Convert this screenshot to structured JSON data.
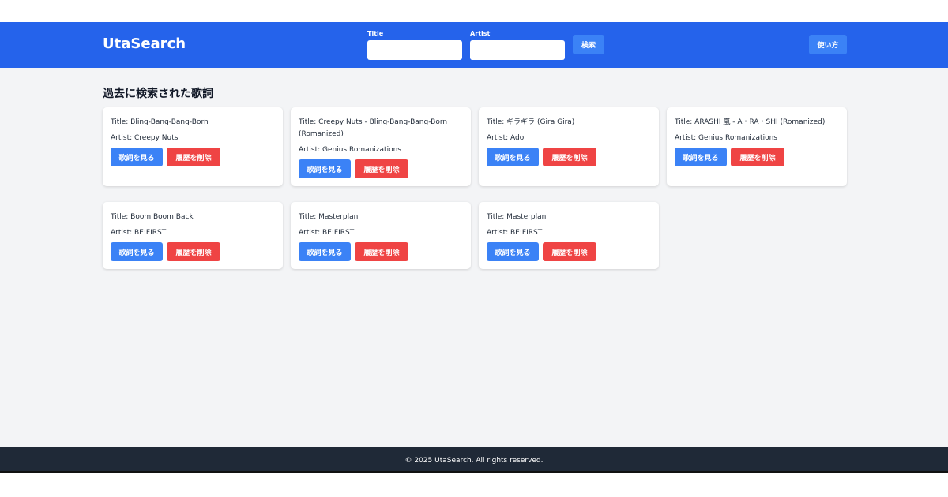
{
  "header": {
    "brand": "UtaSearch",
    "title_label": "Title",
    "artist_label": "Artist",
    "title_value": "",
    "artist_value": "",
    "search_label": "検索",
    "help_label": "使い方"
  },
  "history": {
    "heading": "過去に検索された歌詞",
    "view_label": "歌詞を見る",
    "delete_label": "履歴を削除",
    "items": [
      {
        "title": "Title: Bling-Bang-Bang-Born",
        "artist": "Artist: Creepy Nuts"
      },
      {
        "title": "Title: Creepy Nuts - Bling-Bang-Bang-Born (Romanized)",
        "artist": "Artist: Genius Romanizations"
      },
      {
        "title": "Title: ギラギラ (Gira Gira)",
        "artist": "Artist: Ado"
      },
      {
        "title": "Title: ARASHI 嵐 - A・RA・SHI (Romanized)",
        "artist": "Artist: Genius Romanizations"
      },
      {
        "title": "Title: Boom Boom Back",
        "artist": "Artist: BE:FIRST"
      },
      {
        "title": "Title: Masterplan",
        "artist": "Artist: BE:FIRST"
      },
      {
        "title": "Title: Masterplan",
        "artist": "Artist: BE:FIRST"
      }
    ]
  },
  "footer": {
    "text": "© 2025 UtaSearch. All rights reserved."
  },
  "colors": {
    "primary": "#2563eb",
    "button_blue": "#3b82f6",
    "button_red": "#ef4444",
    "background": "#f3f4f6",
    "footer": "#1f2937"
  }
}
